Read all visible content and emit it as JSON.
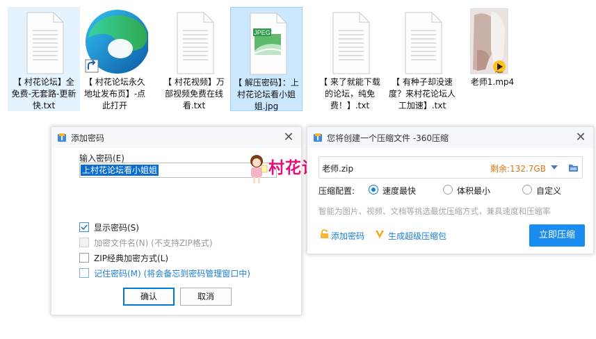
{
  "files": [
    {
      "name": "【 村花论坛】全免费-无套路-更新快.txt",
      "kind": "txt"
    },
    {
      "name": "【 村花论坛永久地址发布页】-点此打开",
      "kind": "edge-shortcut"
    },
    {
      "name": "【 村花视频】万部视频免费在线看.txt",
      "kind": "txt"
    },
    {
      "name": "【 解压密码】：上村花论坛看小姐姐.jpg",
      "kind": "jpeg",
      "thumb_label": "JPEG"
    },
    {
      "name": "【 来了就能下载的论坛，纯免费！】.txt",
      "kind": "txt"
    },
    {
      "name": "【 有种子却没速度？来村花论坛人工加速】.txt",
      "kind": "txt"
    },
    {
      "name": "老师1.mp4",
      "kind": "video",
      "badge_label": "Player"
    }
  ],
  "password_dialog": {
    "title": "添加密码",
    "input_label": "输入密码(E)",
    "input_value": "上村花论坛看小姐姐",
    "checkboxes": [
      {
        "label": "显示密码(S)",
        "checked": true,
        "disabled": false
      },
      {
        "label": "加密文件名(N)  (不支持ZIP格式)",
        "checked": false,
        "disabled": true
      },
      {
        "label": "ZIP经典加密方式(L)",
        "checked": false,
        "disabled": false
      },
      {
        "label": "记住密码(M)  (将会备忘到密码管理窗口中)",
        "checked": false,
        "disabled": false
      }
    ],
    "ok_label": "确认",
    "cancel_label": "取消"
  },
  "watermark": "村花论坛",
  "compress_dialog": {
    "title": "您将创建一个压缩文件 -360压缩",
    "filename": "老师.zip",
    "free_space": "剩余:132.7GB",
    "config_label": "压缩配置:",
    "options": [
      {
        "label": "速度最快",
        "selected": true
      },
      {
        "label": "体积最小",
        "selected": false
      },
      {
        "label": "自定义",
        "selected": false
      }
    ],
    "hint": "智能为图片、视频、文档等挑选最优压缩方式，兼具速度和压缩率",
    "add_password_label": "添加密码",
    "super_pack_label": "生成超级压缩包",
    "compress_button": "立即压缩"
  },
  "colors": {
    "accent": "#1a8cf0",
    "free_space": "#e0760f",
    "link": "#1a7fd4",
    "watermark": "#e4117a",
    "selection": "#cce8ff"
  }
}
